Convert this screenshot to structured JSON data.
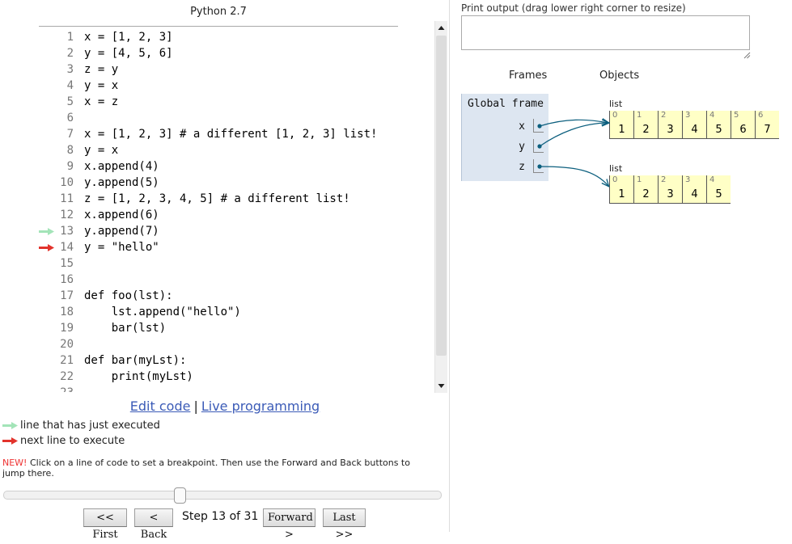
{
  "editor": {
    "language": "Python 2.7",
    "lines": [
      {
        "no": "1",
        "text": "x = [1, 2, 3]"
      },
      {
        "no": "2",
        "text": "y = [4, 5, 6]"
      },
      {
        "no": "3",
        "text": "z = y"
      },
      {
        "no": "4",
        "text": "y = x"
      },
      {
        "no": "5",
        "text": "x = z"
      },
      {
        "no": "6",
        "text": ""
      },
      {
        "no": "7",
        "text": "x = [1, 2, 3] # a different [1, 2, 3] list!"
      },
      {
        "no": "8",
        "text": "y = x"
      },
      {
        "no": "9",
        "text": "x.append(4)"
      },
      {
        "no": "10",
        "text": "y.append(5)"
      },
      {
        "no": "11",
        "text": "z = [1, 2, 3, 4, 5] # a different list!"
      },
      {
        "no": "12",
        "text": "x.append(6)"
      },
      {
        "no": "13",
        "text": "y.append(7)"
      },
      {
        "no": "14",
        "text": "y = \"hello\""
      },
      {
        "no": "15",
        "text": ""
      },
      {
        "no": "16",
        "text": ""
      },
      {
        "no": "17",
        "text": "def foo(lst):"
      },
      {
        "no": "18",
        "text": "    lst.append(\"hello\")"
      },
      {
        "no": "19",
        "text": "    bar(lst)"
      },
      {
        "no": "20",
        "text": ""
      },
      {
        "no": "21",
        "text": "def bar(myLst):"
      },
      {
        "no": "22",
        "text": "    print(myLst)"
      },
      {
        "no": "23",
        "text": ""
      }
    ],
    "just_executed_line": 13,
    "next_line": 14
  },
  "links": {
    "edit_code": "Edit code",
    "separator": "|",
    "live_programming": "Live programming"
  },
  "legend": {
    "executed": "line that has just executed",
    "next": "next line to execute"
  },
  "note": {
    "prefix": "NEW!",
    "text": " Click on a line of code to set a breakpoint. Then use the Forward and Back buttons to jump there."
  },
  "navigation": {
    "first": "<< First",
    "back": "< Back",
    "step_text": "Step 13 of 31",
    "forward": "Forward >",
    "last": "Last >>",
    "current_step": 13,
    "total_steps": 31
  },
  "output": {
    "label": "Print output (drag lower right corner to resize)",
    "content": ""
  },
  "viz": {
    "frames_header": "Frames",
    "objects_header": "Objects",
    "global_frame": {
      "title": "Global frame",
      "vars": [
        "x",
        "y",
        "z"
      ]
    },
    "objects": [
      {
        "type_label": "list",
        "indices": [
          "0",
          "1",
          "2",
          "3",
          "4",
          "5",
          "6"
        ],
        "values": [
          "1",
          "2",
          "3",
          "4",
          "5",
          "6",
          "7"
        ]
      },
      {
        "type_label": "list",
        "indices": [
          "0",
          "1",
          "2",
          "3",
          "4"
        ],
        "values": [
          "1",
          "2",
          "3",
          "4",
          "5"
        ]
      }
    ]
  },
  "colors": {
    "executed_arrow": "#a3e4b8",
    "next_arrow": "#e2332c",
    "link": "#3b5bb7",
    "frame_bg": "#dde6f1",
    "heap_cell": "#ffffc6",
    "pointer": "#0c5f7e"
  }
}
